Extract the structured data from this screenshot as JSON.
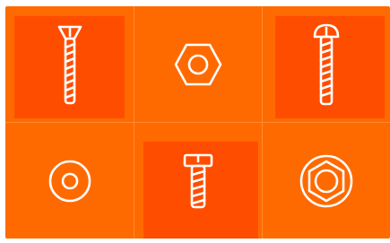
{
  "grid": {
    "accent_color": "#ff6a00",
    "highlight_color": "#ff4d00",
    "icon_color": "#ffffff",
    "tiles": [
      {
        "icon": "countersunk-screw-icon",
        "highlighted": true
      },
      {
        "icon": "hex-nut-icon",
        "highlighted": false
      },
      {
        "icon": "round-head-screw-icon",
        "highlighted": true
      },
      {
        "icon": "washer-icon",
        "highlighted": false
      },
      {
        "icon": "cheese-head-screw-icon",
        "highlighted": true
      },
      {
        "icon": "flanged-hex-nut-icon",
        "highlighted": false
      }
    ]
  }
}
